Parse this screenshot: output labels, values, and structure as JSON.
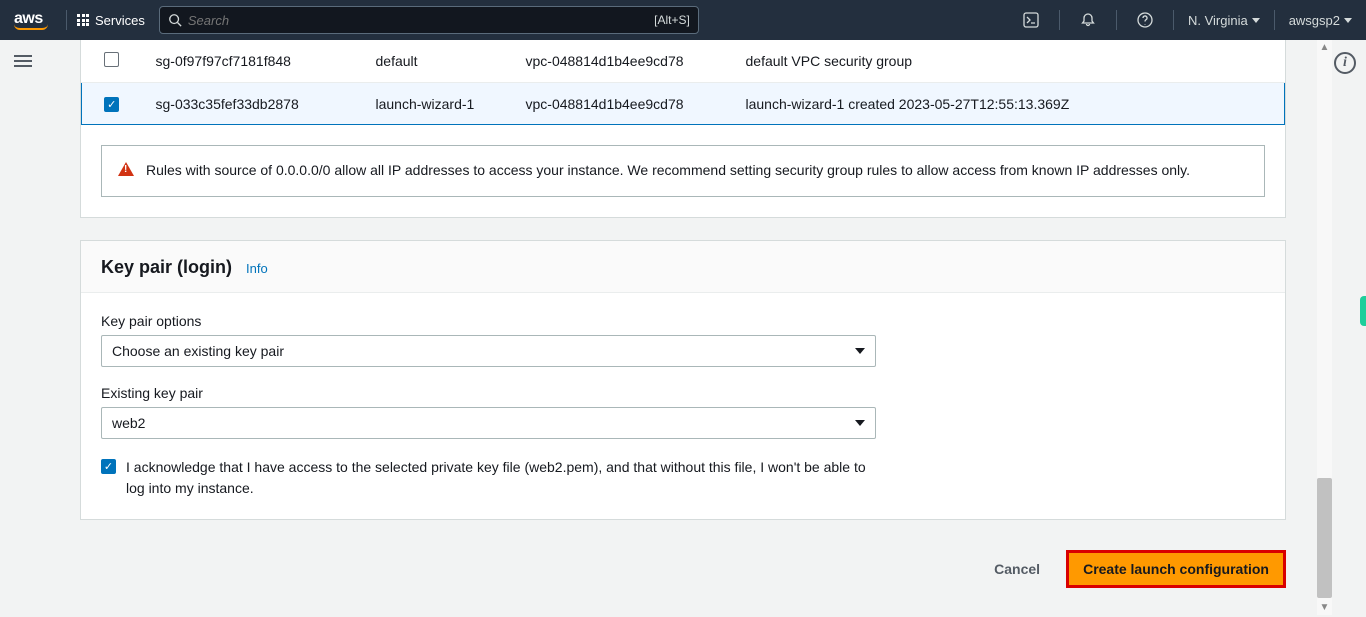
{
  "nav": {
    "logo_text": "aws",
    "services_label": "Services",
    "search_placeholder": "Search",
    "search_shortcut": "[Alt+S]",
    "region": "N. Virginia",
    "account": "awsgsp2"
  },
  "security_groups": {
    "rows": [
      {
        "selected": false,
        "id": "sg-0f97f97cf7181f848",
        "name": "default",
        "vpc": "vpc-048814d1b4ee9cd78",
        "desc": "default VPC security group"
      },
      {
        "selected": true,
        "id": "sg-033c35fef33db2878",
        "name": "launch-wizard-1",
        "vpc": "vpc-048814d1b4ee9cd78",
        "desc": "launch-wizard-1 created 2023-05-27T12:55:13.369Z"
      }
    ],
    "warning": "Rules with source of 0.0.0.0/0 allow all IP addresses to access your instance. We recommend setting security group rules to allow access from known IP addresses only."
  },
  "keypair": {
    "title": "Key pair (login)",
    "info": "Info",
    "options_label": "Key pair options",
    "options_value": "Choose an existing key pair",
    "existing_label": "Existing key pair",
    "existing_value": "web2",
    "ack_text": "I acknowledge that I have access to the selected private key file (web2.pem), and that without this file, I won't be able to log into my instance."
  },
  "actions": {
    "cancel": "Cancel",
    "create": "Create launch configuration"
  }
}
